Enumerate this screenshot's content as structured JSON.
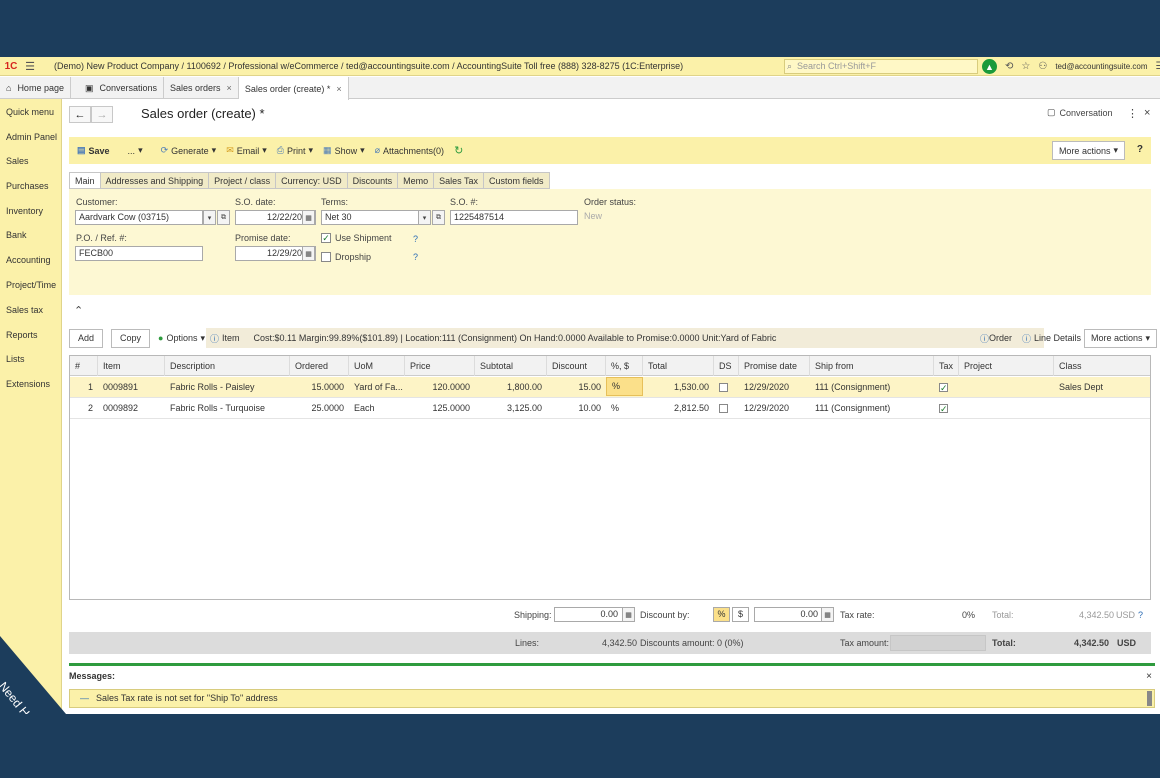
{
  "app": {
    "logo": "1С",
    "title": "(Demo) New Product Company / 1100692 / Professional w/eCommerce / ted@accountingsuite.com / AccountingSuite Toll free (888) 328-8275  (1C:Enterprise)",
    "search_placeholder": "Search Ctrl+Shift+F",
    "user": "ted@accountingsuite.com"
  },
  "tabs": [
    {
      "label": "Home page"
    },
    {
      "label": "Conversations"
    },
    {
      "label": "Sales orders"
    },
    {
      "label": "Sales order (create) *"
    }
  ],
  "nav": [
    "Quick menu",
    "Admin Panel",
    "Sales",
    "Purchases",
    "Inventory",
    "Bank",
    "Accounting",
    "Project/Time",
    "Sales tax",
    "Reports",
    "Lists",
    "Extensions"
  ],
  "need_help": "Need Help",
  "form": {
    "title": "Sales order (create) *",
    "conversation": "Conversation"
  },
  "commands": {
    "save": "Save",
    "dots": "...",
    "generate": "Generate",
    "email": "Email",
    "print": "Print",
    "show": "Show",
    "attachments": "Attachments(0)",
    "more_actions": "More actions",
    "help": "?"
  },
  "subtabs": [
    "Main",
    "Addresses and Shipping",
    "Project / class",
    "Currency: USD",
    "Discounts",
    "Memo",
    "Sales Tax",
    "Custom fields"
  ],
  "fields": {
    "customer_label": "Customer:",
    "customer": "Aardvark Cow (03715)",
    "so_date_label": "S.O. date:",
    "so_date": "12/22/2020",
    "terms_label": "Terms:",
    "terms": "Net 30",
    "so_num_label": "S.O. #:",
    "so_num": "1225487514",
    "order_status_label": "Order status:",
    "order_status": "New",
    "po_label": "P.O. / Ref. #:",
    "po": "FECB00",
    "promise_label": "Promise date:",
    "promise": "12/29/2020",
    "use_shipment": "Use Shipment",
    "dropship": "Dropship",
    "q": "?"
  },
  "linebar": {
    "add": "Add",
    "copy": "Copy",
    "options": "Options",
    "item": "Item",
    "info": "Cost:$0.11 Margin:99.89%($101.89) | Location:111 (Consignment) On Hand:0.0000 Available to Promise:0.0000 Unit:Yard of Fabric",
    "order": "Order",
    "line_details": "Line Details",
    "more_actions": "More actions"
  },
  "grid": {
    "headers": [
      "#",
      "Item",
      "Description",
      "Ordered",
      "UoM",
      "Price",
      "Subtotal",
      "Discount",
      "%, $",
      "Total",
      "DS",
      "Promise date",
      "Ship from",
      "Tax",
      "Project",
      "Class"
    ],
    "rows": [
      {
        "n": "1",
        "item": "0009891",
        "desc": "Fabric Rolls - Paisley",
        "ordered": "15.0000",
        "uom": "Yard of Fa...",
        "price": "120.0000",
        "subtotal": "1,800.00",
        "discount": "15.00",
        "pct": "%",
        "total": "1,530.00",
        "promise": "12/29/2020",
        "ship": "111 (Consignment)",
        "project": "",
        "class": "Sales Dept"
      },
      {
        "n": "2",
        "item": "0009892",
        "desc": "Fabric Rolls - Turquoise",
        "ordered": "25.0000",
        "uom": "Each",
        "price": "125.0000",
        "subtotal": "3,125.00",
        "discount": "10.00",
        "pct": "%",
        "total": "2,812.50",
        "promise": "12/29/2020",
        "ship": "111 (Consignment)",
        "project": "",
        "class": ""
      }
    ]
  },
  "totals": {
    "shipping_label": "Shipping:",
    "shipping": "0.00",
    "discount_by_label": "Discount by:",
    "pct": "%",
    "dollar": "$",
    "discount_value": "0.00",
    "tax_rate_label": "Tax rate:",
    "tax_rate": "0%",
    "total_label": "Total:",
    "total": "4,342.50",
    "currency": "USD",
    "help": "?",
    "lines_label": "Lines:",
    "lines": "4,342.50",
    "discounts_amount": "Discounts amount:  0   (0%)",
    "tax_amount_label": "Tax amount:",
    "total2_label": "Total:",
    "total2": "4,342.50",
    "currency2": "USD"
  },
  "messages": {
    "title": "Messages:",
    "text": "Sales Tax rate is not set for \"Ship To\" address"
  }
}
